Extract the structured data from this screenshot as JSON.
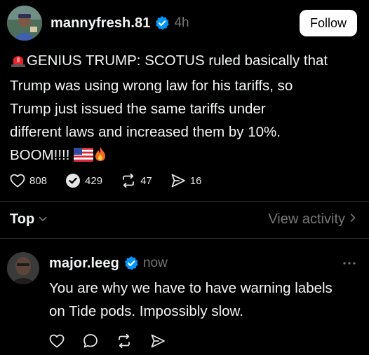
{
  "post": {
    "username": "mannyfresh.81",
    "timestamp": "4h",
    "follow_label": "Follow",
    "text_lines": [
      "GENIUS TRUMP: SCOTUS ruled basically that",
      "Trump was using wrong law for his tariffs, so",
      "Trump just issued the same tariffs under",
      "different laws and increased them by 10%.",
      "BOOM!!!!"
    ],
    "emojis": [
      "rotating-light-emoji",
      "us-flag-emoji",
      "fire-emoji"
    ],
    "actions": {
      "likes": "808",
      "comments": "429",
      "reposts": "47",
      "shares": "16"
    }
  },
  "sort": {
    "label": "Top",
    "view_activity_label": "View activity"
  },
  "reply": {
    "username": "major.leeg",
    "timestamp": "now",
    "text_lines": [
      "You are why we have to have warning labels",
      "on Tide pods. Impossibly slow."
    ]
  },
  "colors": {
    "background": "#000000",
    "text": "#f3f5f7",
    "muted": "#777777",
    "verified": "#0095f6",
    "follow_bg": "#ffffff"
  },
  "icons": [
    "heart-icon",
    "comment-check-icon",
    "repost-icon",
    "share-icon",
    "chevron-down-icon",
    "chevron-right-icon",
    "more-icon",
    "comment-icon",
    "verified-badge-icon"
  ]
}
